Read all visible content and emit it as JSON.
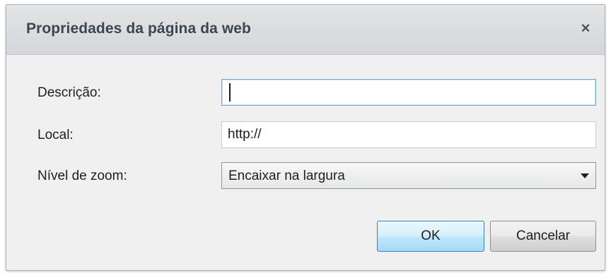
{
  "dialog": {
    "title": "Propriedades da página da web",
    "close_glyph": "×"
  },
  "form": {
    "description_label": "Descrição:",
    "description_value": "",
    "location_label": "Local:",
    "location_value": "http://",
    "zoom_label": "Nível de zoom:",
    "zoom_selected": "Encaixar na largura"
  },
  "buttons": {
    "ok_label": "OK",
    "cancel_label": "Cancelar"
  },
  "icons": {
    "close": "close-icon",
    "dropdown": "chevron-down-icon"
  }
}
